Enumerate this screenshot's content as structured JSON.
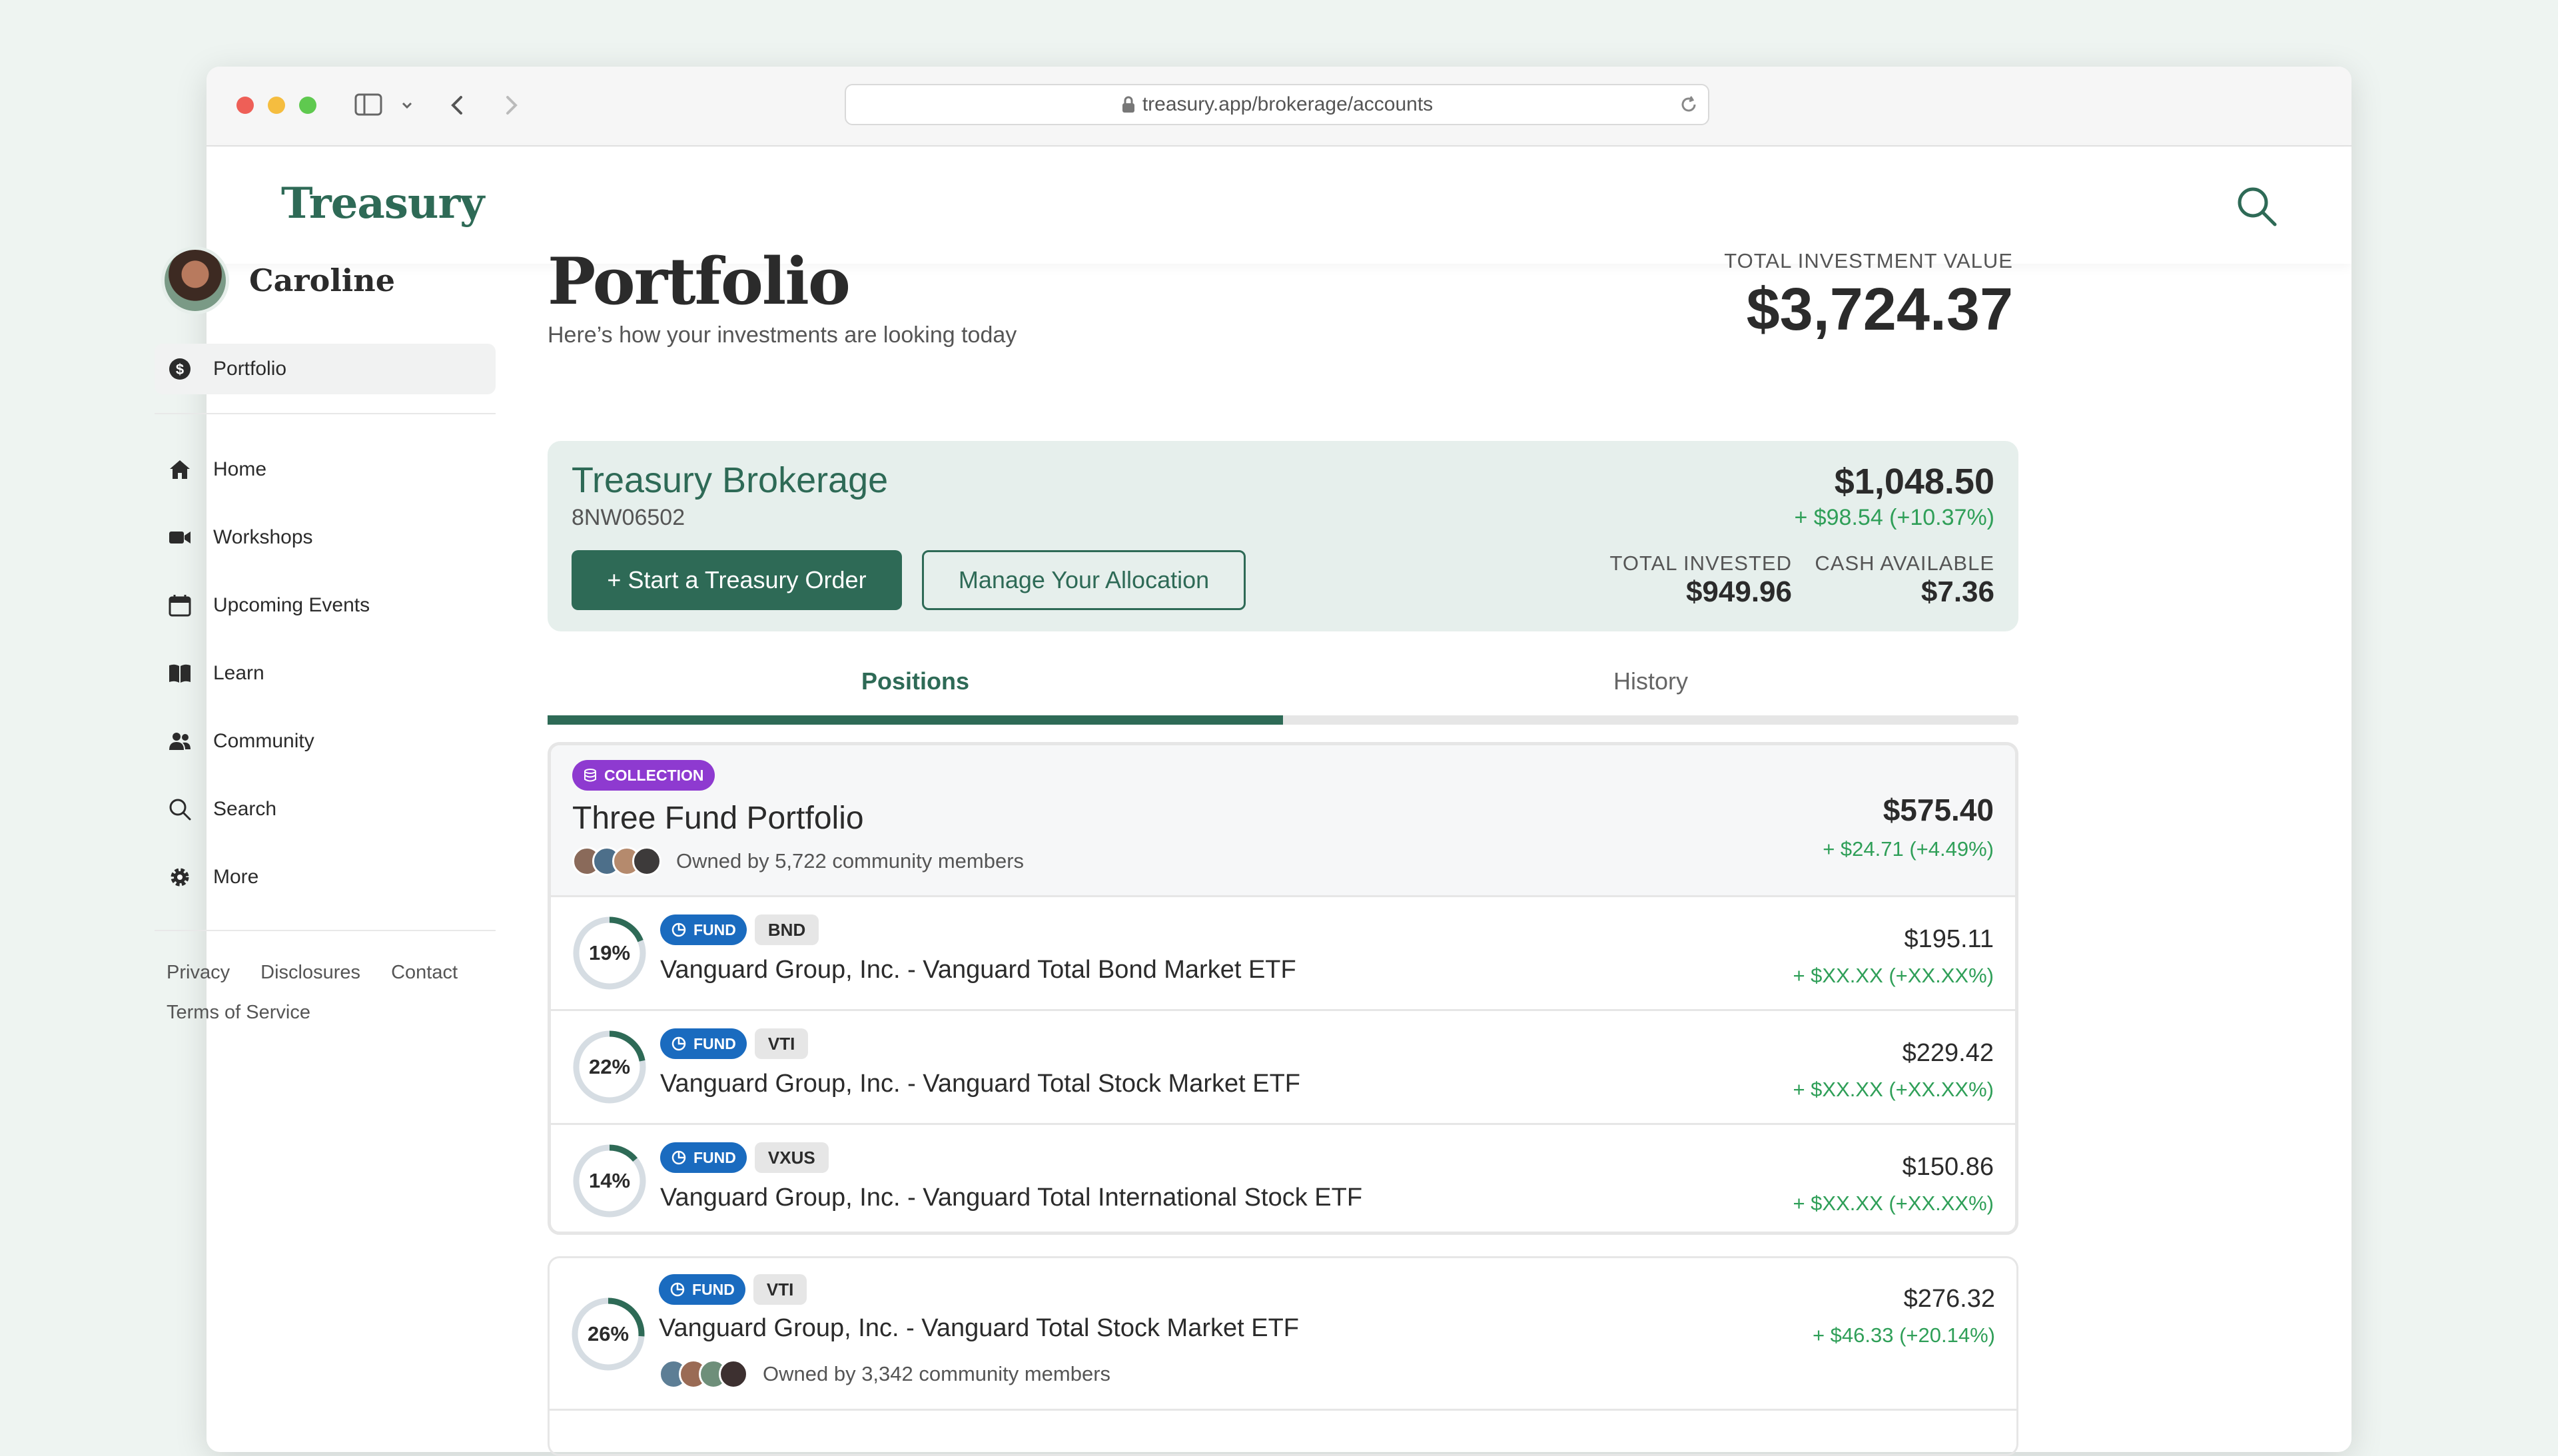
{
  "browser": {
    "url": "treasury.app/brokerage/accounts"
  },
  "app": {
    "logo": "Treasury"
  },
  "sidebar": {
    "user_name": "Caroline",
    "active_item": "Portfolio",
    "items": [
      {
        "label": "Home",
        "icon": "home-icon"
      },
      {
        "label": "Workshops",
        "icon": "video-icon"
      },
      {
        "label": "Upcoming Events",
        "icon": "calendar-icon"
      },
      {
        "label": "Learn",
        "icon": "book-icon"
      },
      {
        "label": "Community",
        "icon": "people-icon"
      },
      {
        "label": "Search",
        "icon": "search-icon"
      },
      {
        "label": "More",
        "icon": "gear-icon"
      }
    ],
    "footer_links": [
      "Privacy",
      "Disclosures",
      "Contact",
      "Terms of Service"
    ]
  },
  "header": {
    "title": "Portfolio",
    "subtitle": "Here’s how your investments are looking today",
    "total_label": "TOTAL INVESTMENT VALUE",
    "total_value": "$3,724.37"
  },
  "brokerage": {
    "name": "Treasury Brokerage",
    "account_id": "8NW06502",
    "value": "$1,048.50",
    "change": "+ $98.54  (+10.37%)",
    "start_order_label": "+ Start a Treasury Order",
    "manage_label": "Manage Your Allocation",
    "total_invested_label": "TOTAL INVESTED",
    "total_invested_value": "$949.96",
    "cash_available_label": "CASH AVAILABLE",
    "cash_available_value": "$7.36"
  },
  "tabs": {
    "positions": "Positions",
    "history": "History",
    "active": "Positions"
  },
  "collection": {
    "badge": "COLLECTION",
    "title": "Three Fund Portfolio",
    "owners_text": "Owned by 5,722 community members",
    "value": "$575.40",
    "change": "+ $24.71 (+4.49%)",
    "positions": [
      {
        "percent_label": "19%",
        "percent": 19,
        "badge": "FUND",
        "ticker": "BND",
        "name": "Vanguard Group, Inc. - Vanguard Total Bond Market ETF",
        "value": "$195.11",
        "change": "+ $XX.XX (+XX.XX%)"
      },
      {
        "percent_label": "22%",
        "percent": 22,
        "badge": "FUND",
        "ticker": "VTI",
        "name": "Vanguard Group, Inc. - Vanguard Total Stock Market ETF",
        "value": "$229.42",
        "change": "+ $XX.XX (+XX.XX%)"
      },
      {
        "percent_label": "14%",
        "percent": 14,
        "badge": "FUND",
        "ticker": "VXUS",
        "name": "Vanguard Group, Inc. - Vanguard Total International Stock ETF",
        "value": "$150.86",
        "change": "+ $XX.XX (+XX.XX%)"
      }
    ]
  },
  "standalone": {
    "percent_label": "26%",
    "percent": 26,
    "badge": "FUND",
    "ticker": "VTI",
    "name": "Vanguard Group, Inc. - Vanguard Total Stock Market ETF",
    "owners_text": "Owned by 3,342 community members",
    "value": "$276.32",
    "change": "+ $46.33 (+20.14%)"
  },
  "colors": {
    "brand": "#2e6a56",
    "positive": "#2f9f58",
    "fund_badge": "#1a6bbf",
    "collection_badge": "#8e3ad0"
  }
}
